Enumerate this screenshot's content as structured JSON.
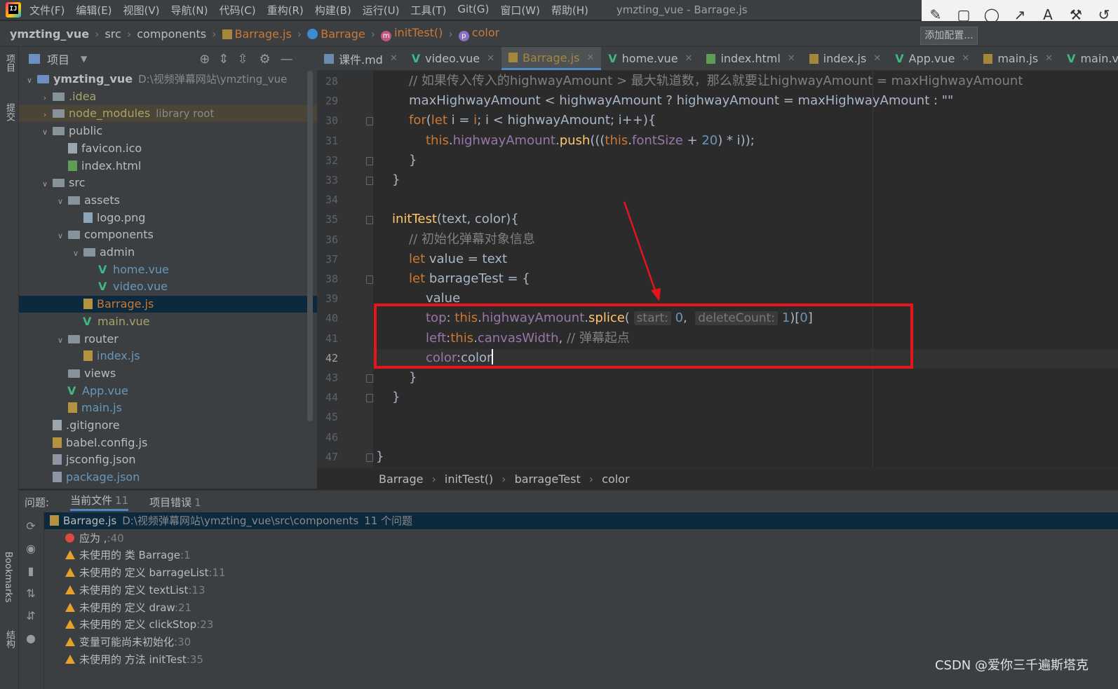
{
  "menu": {
    "items": [
      "文件(F)",
      "编辑(E)",
      "视图(V)",
      "导航(N)",
      "代码(C)",
      "重构(R)",
      "构建(B)",
      "运行(U)",
      "工具(T)",
      "Git(G)",
      "窗口(W)",
      "帮助(H)"
    ],
    "window_title": "ymzting_vue - Barrage.js"
  },
  "draw_tools": [
    "✎",
    "▢",
    "◯",
    "↗",
    "A",
    "⚒",
    "↺"
  ],
  "navbar": {
    "crumbs": [
      "ymzting_vue",
      "src",
      "components",
      "Barrage.js",
      "Barrage",
      "initTest()",
      "color"
    ],
    "run_config": "添加配置..."
  },
  "left_strip": {
    "tabs": [
      "项目",
      "提交",
      "Bookmarks",
      "结构"
    ]
  },
  "project": {
    "header": "项目",
    "tree": [
      {
        "depth": 0,
        "chev": "v",
        "icon": "folder-mod",
        "name": "ymzting_vue",
        "extra": "D:\\视频弹幕网站\\ymzting_vue",
        "style": "bold"
      },
      {
        "depth": 1,
        "chev": ">",
        "icon": "folder",
        "name": ".idea",
        "style": "olive"
      },
      {
        "depth": 1,
        "chev": ">",
        "icon": "folder",
        "name": "node_modules",
        "extra": "library root",
        "style": "olive",
        "hl": true
      },
      {
        "depth": 1,
        "chev": "v",
        "icon": "folder",
        "name": "public"
      },
      {
        "depth": 2,
        "chev": "",
        "icon": "file",
        "name": "favicon.ico"
      },
      {
        "depth": 2,
        "chev": "",
        "icon": "html",
        "name": "index.html"
      },
      {
        "depth": 1,
        "chev": "v",
        "icon": "folder",
        "name": "src"
      },
      {
        "depth": 2,
        "chev": "v",
        "icon": "folder",
        "name": "assets"
      },
      {
        "depth": 3,
        "chev": "",
        "icon": "png",
        "name": "logo.png"
      },
      {
        "depth": 2,
        "chev": "v",
        "icon": "folder",
        "name": "components"
      },
      {
        "depth": 3,
        "chev": "v",
        "icon": "folder",
        "name": "admin"
      },
      {
        "depth": 4,
        "chev": "",
        "icon": "vue",
        "name": "home.vue",
        "style": "blue"
      },
      {
        "depth": 4,
        "chev": "",
        "icon": "vue",
        "name": "video.vue",
        "style": "blue"
      },
      {
        "depth": 3,
        "chev": "",
        "icon": "js",
        "name": "Barrage.js",
        "style": "orangef",
        "selected": true
      },
      {
        "depth": 3,
        "chev": "",
        "icon": "vue",
        "name": "main.vue",
        "style": "olive"
      },
      {
        "depth": 2,
        "chev": "v",
        "icon": "folder",
        "name": "router"
      },
      {
        "depth": 3,
        "chev": "",
        "icon": "js",
        "name": "index.js",
        "style": "blue"
      },
      {
        "depth": 2,
        "chev": "",
        "icon": "folder",
        "name": "views"
      },
      {
        "depth": 2,
        "chev": "",
        "icon": "vue",
        "name": "App.vue",
        "style": "blue"
      },
      {
        "depth": 2,
        "chev": "",
        "icon": "js",
        "name": "main.js",
        "style": "blue"
      },
      {
        "depth": 1,
        "chev": "",
        "icon": "file",
        "name": ".gitignore"
      },
      {
        "depth": 1,
        "chev": "",
        "icon": "js",
        "name": "babel.config.js"
      },
      {
        "depth": 1,
        "chev": "",
        "icon": "json",
        "name": "jsconfig.json"
      },
      {
        "depth": 1,
        "chev": "",
        "icon": "json",
        "name": "package.json",
        "style": "blue"
      }
    ]
  },
  "editor_tabs": [
    {
      "label": "课件.md",
      "icon": "md"
    },
    {
      "label": "video.vue",
      "icon": "vue"
    },
    {
      "label": "Barrage.js",
      "icon": "js",
      "active": true
    },
    {
      "label": "home.vue",
      "icon": "vue"
    },
    {
      "label": "index.html",
      "icon": "html"
    },
    {
      "label": "index.js",
      "icon": "js"
    },
    {
      "label": "App.vue",
      "icon": "vue"
    },
    {
      "label": "main.js",
      "icon": "js"
    },
    {
      "label": "main.vue",
      "icon": "vue"
    }
  ],
  "code": {
    "current_line": 42,
    "lines": [
      {
        "n": 28,
        "indent": 1,
        "tokens": [
          [
            "cmt",
            "// 如果传入传入的highwayAmount > 最大轨道数，那么就要让highwayAmount = maxHighwayAmount"
          ]
        ]
      },
      {
        "n": 29,
        "indent": 1,
        "tokens": [
          [
            "",
            "maxHighwayAmount < highwayAmount ? highwayAmount = maxHighwayAmount : \"\""
          ]
        ]
      },
      {
        "n": 30,
        "indent": 1,
        "tokens": [
          [
            "kw",
            "for"
          ],
          [
            "",
            "("
          ],
          [
            "kw",
            "let"
          ],
          [
            "",
            " i = "
          ],
          [
            "kw",
            "i"
          ],
          [
            "",
            "; i < highwayAmount; i++){"
          ]
        ]
      },
      {
        "n": 31,
        "indent": 2,
        "tokens": [
          [
            "kw",
            "this"
          ],
          [
            "",
            "."
          ],
          [
            "fld",
            "highwayAmount"
          ],
          [
            "",
            "."
          ],
          [
            "fn",
            "push"
          ],
          [
            "",
            "((("
          ],
          [
            "kw",
            "this"
          ],
          [
            "",
            "."
          ],
          [
            "fld",
            "fontSize"
          ],
          [
            "",
            " + "
          ],
          [
            "num",
            "20"
          ],
          [
            "",
            ") * i));"
          ]
        ]
      },
      {
        "n": 32,
        "indent": 1,
        "tokens": [
          [
            "",
            "}"
          ]
        ]
      },
      {
        "n": 33,
        "indent": 0,
        "tokens": [
          [
            "",
            "}"
          ]
        ]
      },
      {
        "n": 34,
        "indent": 0,
        "tokens": []
      },
      {
        "n": 35,
        "indent": 0,
        "tokens": [
          [
            "fn",
            "initTest"
          ],
          [
            "",
            "(text, color){"
          ]
        ]
      },
      {
        "n": 36,
        "indent": 1,
        "tokens": [
          [
            "cmt",
            "// 初始化弹幕对象信息"
          ]
        ]
      },
      {
        "n": 37,
        "indent": 1,
        "tokens": [
          [
            "kw",
            "let"
          ],
          [
            "",
            " value = text"
          ]
        ]
      },
      {
        "n": 38,
        "indent": 1,
        "tokens": [
          [
            "kw",
            "let"
          ],
          [
            "",
            " barrageTest = {"
          ]
        ]
      },
      {
        "n": 39,
        "indent": 2,
        "tokens": [
          [
            "",
            "value"
          ]
        ]
      },
      {
        "n": 40,
        "indent": 2,
        "tokens": [
          [
            "fld",
            "top"
          ],
          [
            "",
            ": "
          ],
          [
            "kw",
            "this"
          ],
          [
            "",
            "."
          ],
          [
            "fld",
            "highwayAmount"
          ],
          [
            "",
            "."
          ],
          [
            "fn",
            "splice"
          ],
          [
            "",
            "( "
          ],
          [
            "hint",
            "start:"
          ],
          [
            "",
            " "
          ],
          [
            "num",
            "0"
          ],
          [
            "",
            ",  "
          ],
          [
            "hint",
            "deleteCount:"
          ],
          [
            "",
            " "
          ],
          [
            "num",
            "1"
          ],
          [
            "",
            ")["
          ],
          [
            "num",
            "0"
          ],
          [
            "",
            "]"
          ]
        ]
      },
      {
        "n": 41,
        "indent": 2,
        "tokens": [
          [
            "fld",
            "left"
          ],
          [
            "",
            ":"
          ],
          [
            "kw",
            "this"
          ],
          [
            "",
            "."
          ],
          [
            "fld",
            "canvasWidth"
          ],
          [
            "",
            ", "
          ],
          [
            "cmt",
            "// 弹幕起点"
          ]
        ]
      },
      {
        "n": 42,
        "indent": 2,
        "tokens": [
          [
            "fld",
            "color"
          ],
          [
            "",
            ":color"
          ],
          [
            "caret",
            ""
          ]
        ]
      },
      {
        "n": 43,
        "indent": 1,
        "tokens": [
          [
            "",
            "}"
          ]
        ]
      },
      {
        "n": 44,
        "indent": 0,
        "tokens": [
          [
            "",
            "}"
          ]
        ]
      },
      {
        "n": 45,
        "indent": 0,
        "tokens": []
      },
      {
        "n": 46,
        "indent": 0,
        "tokens": []
      },
      {
        "n": 47,
        "indent": -1,
        "tokens": [
          [
            "",
            "}"
          ]
        ]
      }
    ]
  },
  "editor_breadcrumb": [
    "Barrage",
    "initTest()",
    "barrageTest",
    "color"
  ],
  "problems": {
    "label": "问题:",
    "tabs": [
      {
        "label": "当前文件",
        "count": "11"
      },
      {
        "label": "项目错误",
        "count": "1"
      }
    ],
    "file_row": {
      "name": "Barrage.js",
      "path": "D:\\视频弹幕网站\\ymzting_vue\\src\\components",
      "count": "11 个问题"
    },
    "items": [
      {
        "type": "error",
        "text": "应为 ,",
        "line": ":40"
      },
      {
        "type": "warning",
        "text": "未使用的 类 Barrage",
        "line": ":1"
      },
      {
        "type": "warning",
        "text": "未使用的 定义 barrageList",
        "line": ":11"
      },
      {
        "type": "warning",
        "text": "未使用的 定义 textList",
        "line": ":13"
      },
      {
        "type": "warning",
        "text": "未使用的 定义 draw",
        "line": ":21"
      },
      {
        "type": "warning",
        "text": "未使用的 定义 clickStop",
        "line": ":23"
      },
      {
        "type": "warning",
        "text": "变量可能尚未初始化",
        "line": ":30"
      },
      {
        "type": "warning",
        "text": "未使用的 方法 initTest",
        "line": ":35"
      }
    ]
  },
  "watermark": "CSDN @爱你三千遍斯塔克",
  "colors": {
    "highlight_box": "#e8141c",
    "accent": "#4a88c7"
  }
}
